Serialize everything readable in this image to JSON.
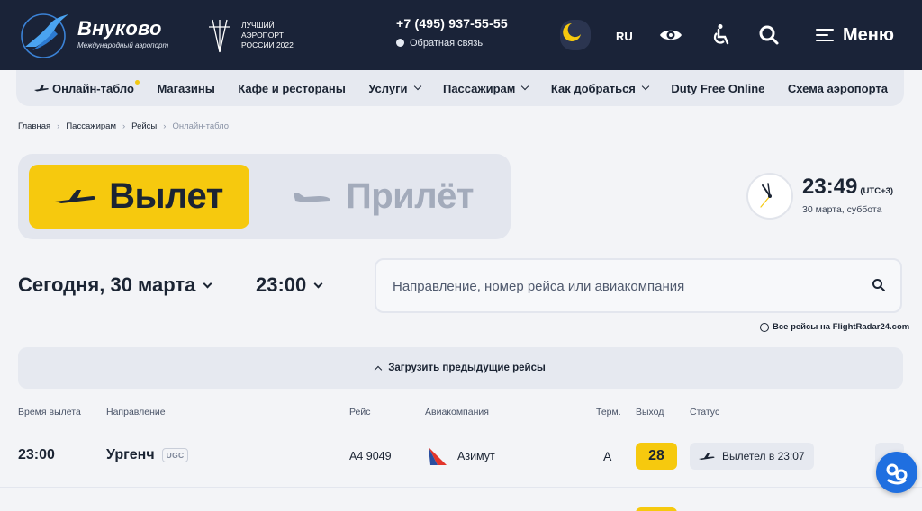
{
  "header": {
    "logo_title": "Внуково",
    "logo_subtitle": "Международный аэропорт",
    "award_text": "ЛУЧШИЙ\nАЭРОПОРТ\nРОССИИ 2022",
    "phone": "+7 (495) 937-55-55",
    "feedback": "Обратная связь",
    "lang": "RU",
    "menu_label": "Меню",
    "icons": [
      "moon-icon",
      "eye-icon",
      "accessibility-icon",
      "search-icon",
      "menu-icon"
    ]
  },
  "nav": {
    "items": [
      {
        "label": "Онлайн-табло",
        "icon": "plane-icon",
        "dropdown": false
      },
      {
        "label": "Магазины",
        "dropdown": false
      },
      {
        "label": "Кафе и рестораны",
        "dropdown": false
      },
      {
        "label": "Услуги",
        "dropdown": true
      },
      {
        "label": "Пассажирам",
        "dropdown": true
      },
      {
        "label": "Как добраться",
        "dropdown": true
      },
      {
        "label": "Duty Free Online",
        "dropdown": false
      },
      {
        "label": "Схема аэропорта",
        "dropdown": false
      }
    ]
  },
  "breadcrumbs": [
    "Главная",
    "Пассажирам",
    "Рейсы",
    "Онлайн-табло"
  ],
  "board": {
    "departure_label": "Вылет",
    "arrival_label": "Прилёт",
    "time": "23:49",
    "utc": "(UTC+3)",
    "date": "30 марта, суббота"
  },
  "filters": {
    "date": "Сегодня, 30 марта",
    "time": "23:00",
    "search_placeholder": "Направление, номер рейса или авиакомпания",
    "flightradar": "Все рейсы на FlightRadar24.com",
    "load_previous": "Загрузить предыдущие рейсы"
  },
  "table": {
    "headers": {
      "time": "Время вылета",
      "dest": "Направление",
      "flight": "Рейс",
      "airline": "Авиакомпания",
      "term": "Терм.",
      "gate": "Выход",
      "status": "Статус"
    },
    "rows": [
      {
        "time": "23:00",
        "destination": "Ургенч",
        "code": "UGC",
        "flight": "А4 9049",
        "airline": "Азимут",
        "terminal": "А",
        "gate": "28",
        "status": "Вылетел в 23:07"
      }
    ]
  },
  "colors": {
    "header_bg": "#1a2338",
    "accent_yellow": "#f6c90e",
    "nav_bg": "#e6e9f0",
    "help_blue": "#1f6fe0"
  }
}
